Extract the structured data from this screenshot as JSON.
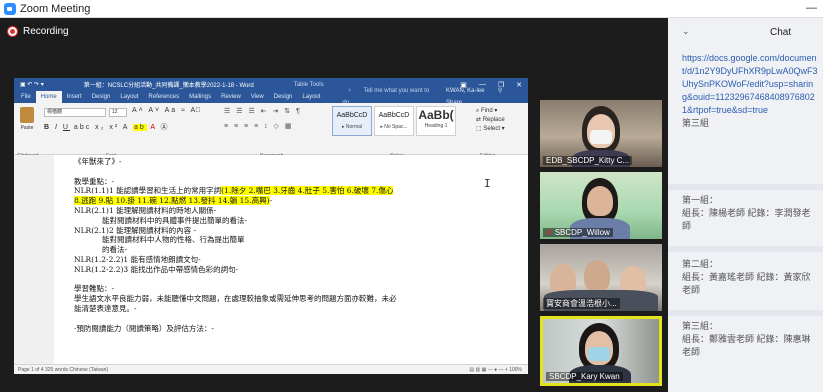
{
  "window": {
    "title": "Zoom Meeting",
    "minimize": "—"
  },
  "recording": {
    "label": "Recording"
  },
  "word": {
    "doc_title": "第一組：NCSLC分組活動_共同備課_懶本教學2022-1-18 - Word",
    "table_tools": "Table Tools",
    "tabs": [
      "File",
      "Home",
      "Insert",
      "Design",
      "Layout",
      "References",
      "Mailings",
      "Review",
      "View",
      "Design",
      "Layout"
    ],
    "tell_me": "Tell me what you want to do",
    "user": "KWAN, Ka-lee",
    "share": "Share",
    "paste": "Paste",
    "font_name": "標楷體",
    "font_size": "12",
    "style_cards": [
      {
        "sample": "AaBbCcD",
        "name": "▸ Normal"
      },
      {
        "sample": "AaBbCcD",
        "name": "▸ No Spac..."
      },
      {
        "sample": "AaBb(",
        "name": "Heading 1"
      }
    ],
    "editing": [
      "Find ▾",
      "Replace",
      "Select ▾"
    ],
    "groups": [
      "Clipboard",
      "Font",
      "Paragraph",
      "Styles",
      "Editing"
    ],
    "doc_lines": [
      "《年獸來了》-",
      "",
      "教學重點：-",
      "NLR(1.1)1 能認讀學習和生活上的常用字詞(1.除夕 2.嘴巴 3.牙齒 4.肚子 5.害怕 6.破壞 7.傷心",
      "8.逃跑 9.貼 10.掛 11.碗 12.點燃 13.發抖 14.躺 15.高興)-",
      "NLR(2.1)1 能理解閱讀材料的時地人關係-",
      "能對閱讀材料中的具體事件提出簡單的看法-",
      "NLR(2.1)2 能理解閱讀材料的內容 -",
      "能對閱讀材料中人物的性格、行為提出簡單",
      "的看法-",
      "NLR(1.2-2.2)1 能有感情地朗讀文句-",
      "NLR(1.2-2.2)3 能找出作品中帶感情色彩的詞句-",
      "",
      "學習難點：-",
      "學生語文水平良能力弱，未能聽懂中文問題，在處理較抽象或需延伸思考的問題方面亦較難，未必",
      "能清楚表達意見。-",
      "",
      "·預防閱讀能力（閱讀策略）及評估方法：-"
    ],
    "status_left": "Page 1 of 4   325 words   Chinese (Taiwan)",
    "zoom": "100%"
  },
  "tiles": [
    {
      "name": "EDB_SBCDP_Kitty C...",
      "muted": false,
      "active": false
    },
    {
      "name": "SBCDP_Willow",
      "muted": true,
      "active": false
    },
    {
      "name": "寶安商會溫浩根小...",
      "muted": false,
      "active": false
    },
    {
      "name": "SBCDP_Kary Kwan",
      "muted": false,
      "active": true
    }
  ],
  "chat": {
    "title": "Chat",
    "link": "https://docs.google.com/document/d/1n2Y9DyUFhXR9pLwA0QwF3UhySnPKOWoF/edit?usp=sharing&ouid=112329674684089768021&rtpof=true&sd=true",
    "messages": [
      "第三組",
      "第一組：\n組長：陳楊老師 紀錄：李潤發老師",
      "第二組：\n組長：黃嘉瑤老師 紀錄：黃家欣老師",
      "第三組：\n組長：鄭雅雲老師 紀錄：陳惠琳老師"
    ]
  }
}
